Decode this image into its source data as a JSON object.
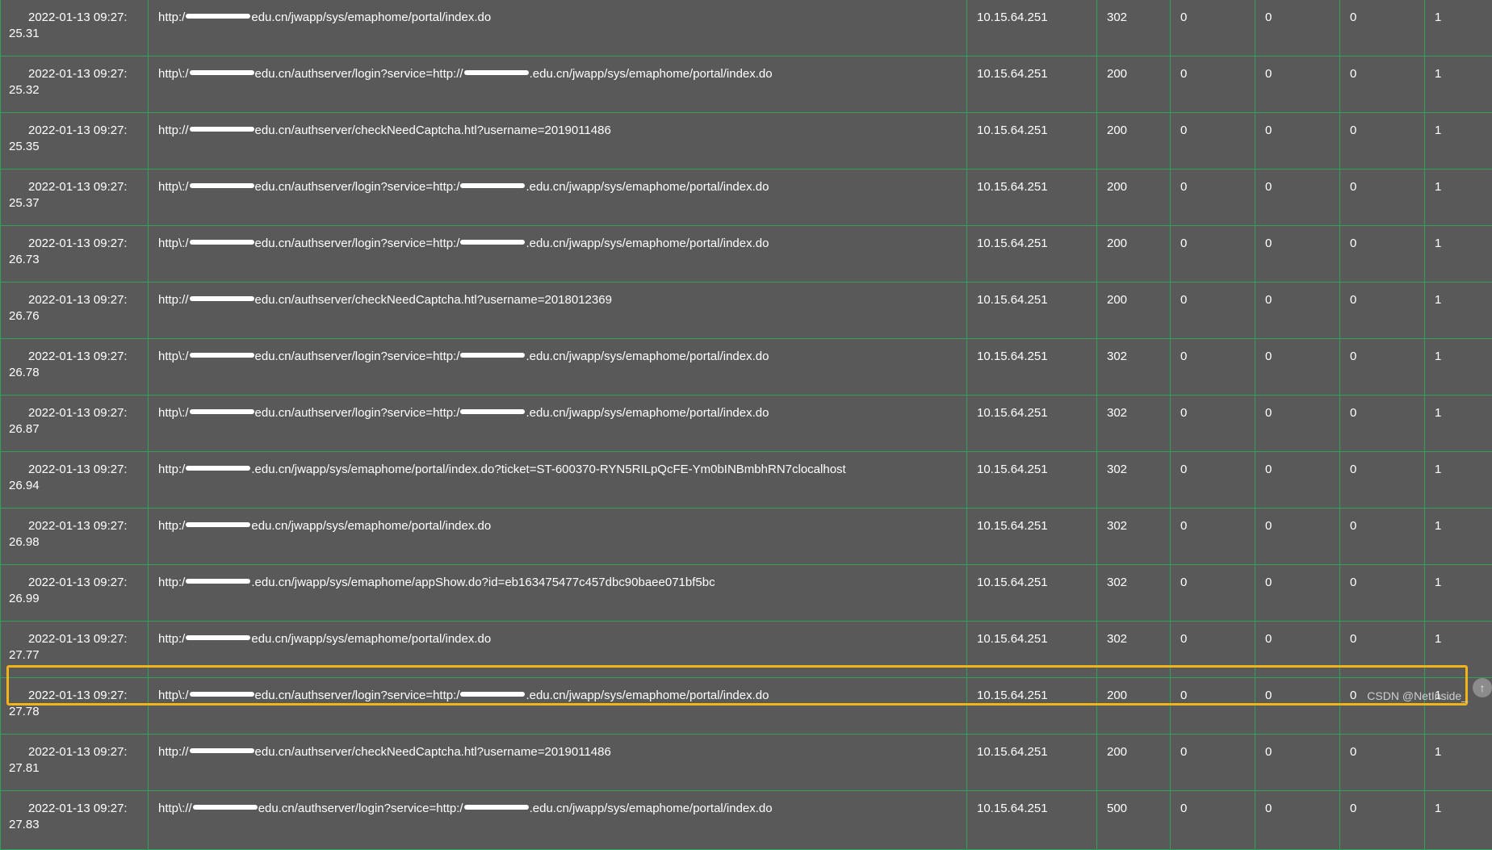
{
  "rows": [
    {
      "date": "2022-01-13 09:27:",
      "sec": "25.31",
      "url_a": "http:/",
      "url_b": "edu.cn/jwapp/sys/emaphome/portal/index.do",
      "ip": "10.15.64.251",
      "status": "302",
      "c1": "0",
      "c2": "0",
      "c3": "0",
      "c4": "1"
    },
    {
      "date": "2022-01-13 09:27:",
      "sec": "25.32",
      "url_a": "http\\:/",
      "url_b": "edu.cn/authserver/login?service=http://",
      "url_c": ".edu.cn/jwapp/sys/emaphome/portal/index.do",
      "ip": "10.15.64.251",
      "status": "200",
      "c1": "0",
      "c2": "0",
      "c3": "0",
      "c4": "1"
    },
    {
      "date": "2022-01-13 09:27:",
      "sec": "25.35",
      "url_a": "http://",
      "url_b": "edu.cn/authserver/checkNeedCaptcha.htl?username=2019011486",
      "ip": "10.15.64.251",
      "status": "200",
      "c1": "0",
      "c2": "0",
      "c3": "0",
      "c4": "1"
    },
    {
      "date": "2022-01-13 09:27:",
      "sec": "25.37",
      "url_a": "http\\:/",
      "url_b": "edu.cn/authserver/login?service=http:/",
      "url_c": ".edu.cn/jwapp/sys/emaphome/portal/index.do",
      "ip": "10.15.64.251",
      "status": "200",
      "c1": "0",
      "c2": "0",
      "c3": "0",
      "c4": "1"
    },
    {
      "date": "2022-01-13 09:27:",
      "sec": "26.73",
      "url_a": "http\\:/",
      "url_b": "edu.cn/authserver/login?service=http:/",
      "url_c": ".edu.cn/jwapp/sys/emaphome/portal/index.do",
      "ip": "10.15.64.251",
      "status": "200",
      "c1": "0",
      "c2": "0",
      "c3": "0",
      "c4": "1"
    },
    {
      "date": "2022-01-13 09:27:",
      "sec": "26.76",
      "url_a": "http://",
      "url_b": "edu.cn/authserver/checkNeedCaptcha.htl?username=2018012369",
      "ip": "10.15.64.251",
      "status": "200",
      "c1": "0",
      "c2": "0",
      "c3": "0",
      "c4": "1"
    },
    {
      "date": "2022-01-13 09:27:",
      "sec": "26.78",
      "url_a": "http\\:/",
      "url_b": "edu.cn/authserver/login?service=http:/",
      "url_c": ".edu.cn/jwapp/sys/emaphome/portal/index.do",
      "ip": "10.15.64.251",
      "status": "302",
      "c1": "0",
      "c2": "0",
      "c3": "0",
      "c4": "1"
    },
    {
      "date": "2022-01-13 09:27:",
      "sec": "26.87",
      "url_a": "http\\:/",
      "url_b": "edu.cn/authserver/login?service=http:/",
      "url_c": ".edu.cn/jwapp/sys/emaphome/portal/index.do",
      "ip": "10.15.64.251",
      "status": "302",
      "c1": "0",
      "c2": "0",
      "c3": "0",
      "c4": "1"
    },
    {
      "date": "2022-01-13 09:27:",
      "sec": "26.94",
      "url_a": "http:/",
      "url_b": ".edu.cn/jwapp/sys/emaphome/portal/index.do?ticket=ST-600370-RYN5RILpQcFE-Ym0bINBmbhRN7clocalhost",
      "ip": "10.15.64.251",
      "status": "302",
      "c1": "0",
      "c2": "0",
      "c3": "0",
      "c4": "1"
    },
    {
      "date": "2022-01-13 09:27:",
      "sec": "26.98",
      "url_a": "http:/",
      "url_b": "edu.cn/jwapp/sys/emaphome/portal/index.do",
      "ip": "10.15.64.251",
      "status": "302",
      "c1": "0",
      "c2": "0",
      "c3": "0",
      "c4": "1"
    },
    {
      "date": "2022-01-13 09:27:",
      "sec": "26.99",
      "url_a": "http:/",
      "url_b": ".edu.cn/jwapp/sys/emaphome/appShow.do?id=eb163475477c457dbc90baee071bf5bc",
      "ip": "10.15.64.251",
      "status": "302",
      "c1": "0",
      "c2": "0",
      "c3": "0",
      "c4": "1"
    },
    {
      "date": "2022-01-13 09:27:",
      "sec": "27.77",
      "url_a": "http:/",
      "url_b": "edu.cn/jwapp/sys/emaphome/portal/index.do",
      "ip": "10.15.64.251",
      "status": "302",
      "c1": "0",
      "c2": "0",
      "c3": "0",
      "c4": "1"
    },
    {
      "date": "2022-01-13 09:27:",
      "sec": "27.78",
      "url_a": "http\\:/",
      "url_b": "edu.cn/authserver/login?service=http:/",
      "url_c": ".edu.cn/jwapp/sys/emaphome/portal/index.do",
      "ip": "10.15.64.251",
      "status": "200",
      "c1": "0",
      "c2": "0",
      "c3": "0",
      "c4": "1"
    },
    {
      "date": "2022-01-13 09:27:",
      "sec": "27.81",
      "url_a": "http://",
      "url_b": "edu.cn/authserver/checkNeedCaptcha.htl?username=2019011486",
      "ip": "10.15.64.251",
      "status": "200",
      "c1": "0",
      "c2": "0",
      "c3": "0",
      "c4": "1"
    },
    {
      "date": "2022-01-13 09:27:",
      "sec": "27.83",
      "url_a": "http\\://",
      "url_b": "edu.cn/authserver/login?service=http:/",
      "url_c": ".edu.cn/jwapp/sys/emaphome/portal/index.do",
      "ip": "10.15.64.251",
      "status": "500",
      "c1": "0",
      "c2": "0",
      "c3": "0",
      "c4": "1"
    }
  ],
  "watermark": "CSDN @NetInside_",
  "colors": {
    "background": "#595959",
    "grid_lines": "#2fa25a",
    "highlight_border": "#f2b418",
    "text": "#ffffff"
  },
  "icons": {
    "scroll_top": "arrow-up-icon"
  }
}
